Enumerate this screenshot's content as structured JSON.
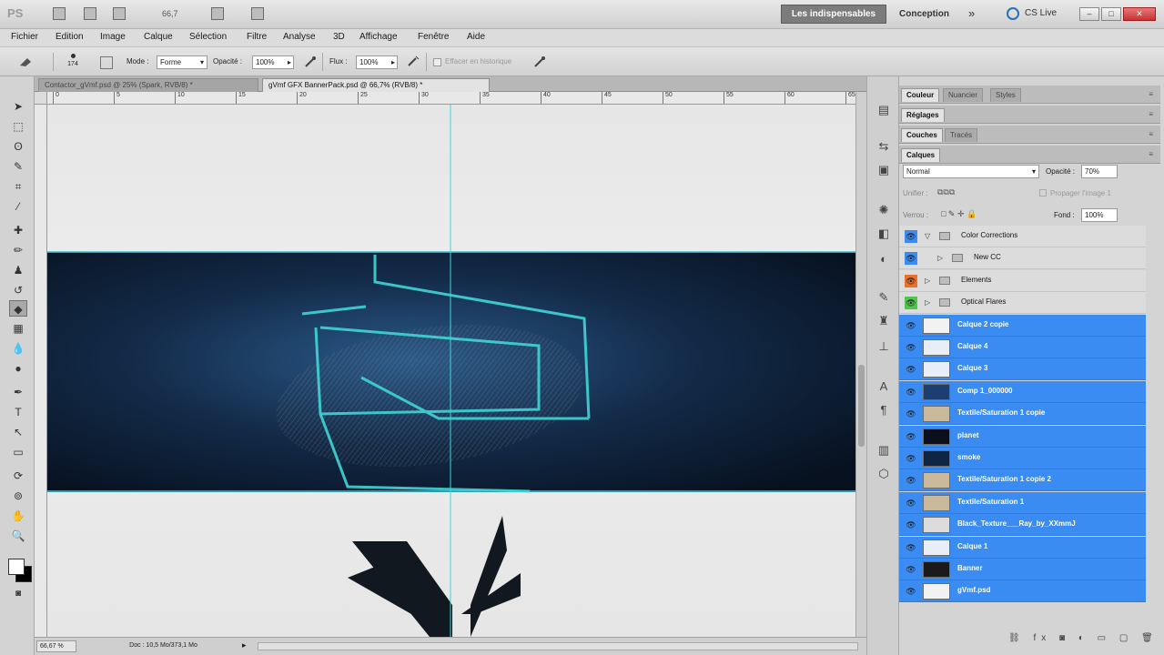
{
  "app": {
    "logo": "PS",
    "zoom_text": "66,7",
    "workspace_active": "Les indispensables",
    "workspace_other": "Conception",
    "more": "»",
    "cs_live": "CS Live",
    "win_min": "–",
    "win_max": "□",
    "win_close": "✕"
  },
  "menu": {
    "items": [
      "Fichier",
      "Edition",
      "Image",
      "Calque",
      "Sélection",
      "Filtre",
      "Analyse",
      "3D",
      "Affichage",
      "Fenêtre",
      "Aide"
    ]
  },
  "options": {
    "brush_size": "174",
    "mode_label": "Mode :",
    "mode_value": "Forme",
    "opacity_label": "Opacité :",
    "opacity_value": "100%",
    "flow_label": "Flux :",
    "flow_value": "100%",
    "sample_label": "Effacer en historique"
  },
  "tabs": [
    {
      "label": "Contactor_gVmf.psd @ 25% (Spark, RVB/8) *",
      "active": false
    },
    {
      "label": "gVmf GFX BannerPack.psd @ 66,7% (RVB/8) *",
      "active": true
    }
  ],
  "ruler": {
    "h_labels": [
      "0",
      "5",
      "10",
      "15",
      "20",
      "25",
      "30",
      "35",
      "40",
      "45",
      "50",
      "55",
      "60",
      "65",
      "70",
      "75"
    ]
  },
  "status": {
    "zoom": "66,67 %",
    "doc": "Doc : 10,5 Mo/373,1 Mo"
  },
  "panels": {
    "group1_tabs": [
      "Couleur",
      "Nuancier",
      "Styles"
    ],
    "group2_tabs": [
      "Réglages"
    ],
    "group3_tabs": [
      "Couches",
      "Tracés"
    ],
    "layers_tab": "Calques",
    "blend_mode": "Normal",
    "opacity_label": "Opacité :",
    "opacity_value": "70%",
    "unify_label": "Unifier :",
    "propagate_label": "Propager l'image 1",
    "lock_label": "Verrou :",
    "fill_label": "Fond :",
    "fill_value": "100%",
    "menu_glyph": "≡"
  },
  "layers": [
    {
      "name": "Color Corrections",
      "type": "group",
      "expanded": true,
      "indent": 0,
      "eye_color": "#3a8cf2"
    },
    {
      "name": "New CC",
      "type": "group",
      "expanded": false,
      "indent": 1,
      "eye_color": "#3a8cf2"
    },
    {
      "name": "Elements",
      "type": "group",
      "expanded": false,
      "indent": 0,
      "eye_color": "#e8702a"
    },
    {
      "name": "Optical Flares",
      "type": "group",
      "expanded": false,
      "indent": 0,
      "eye_color": "#4fc44f"
    },
    {
      "name": "Calque 2 copie",
      "type": "layer",
      "thumb": "#f2f2f2"
    },
    {
      "name": "Calque 4",
      "type": "layer",
      "thumb": "#e8eef8"
    },
    {
      "name": "Calque 3",
      "type": "layer",
      "thumb": "#e8eef8"
    },
    {
      "name": "Comp 1_000000",
      "type": "layer",
      "thumb": "#1c3f73"
    },
    {
      "name": "Textile/Saturation 1 copie",
      "type": "layer",
      "thumb": "#c9b89a"
    },
    {
      "name": "planet",
      "type": "layer",
      "thumb": "#0a0f1e"
    },
    {
      "name": "smoke",
      "type": "layer",
      "thumb": "#0e2444"
    },
    {
      "name": "Textile/Saturation 1 copie 2",
      "type": "layer",
      "thumb": "#c9b89a"
    },
    {
      "name": "Textile/Saturation 1",
      "type": "layer",
      "thumb": "#c9b89a"
    },
    {
      "name": "Black_Texture___Ray_by_XXmmJ",
      "type": "layer",
      "thumb": "#dcdcdc"
    },
    {
      "name": "Calque 1",
      "type": "layer",
      "thumb": "#e8eef8"
    },
    {
      "name": "Banner",
      "type": "layer",
      "thumb": "#1a1a1a"
    },
    {
      "name": "gVmf.psd",
      "type": "layer",
      "thumb": "#f2f2f2"
    }
  ]
}
